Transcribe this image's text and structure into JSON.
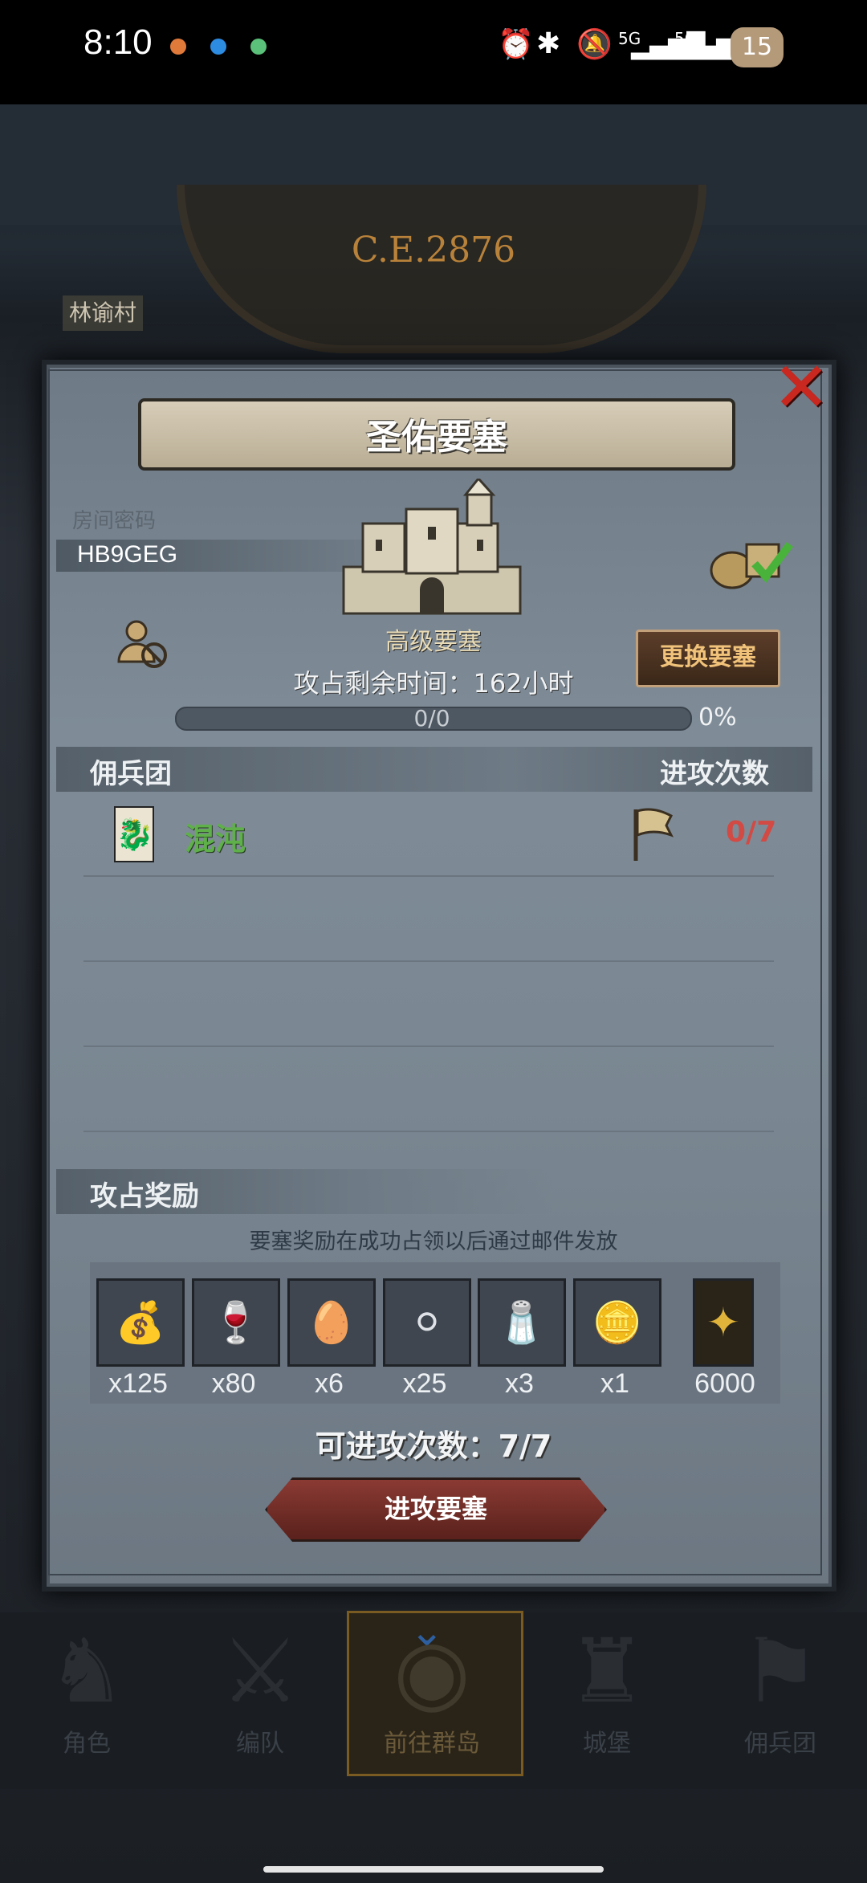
{
  "status_bar": {
    "time": "8:10",
    "battery": "15",
    "signal1": "5G",
    "signal2": "5G"
  },
  "background": {
    "era": "C.E.2876",
    "village": "林谕村"
  },
  "dialog": {
    "title": "圣佑要塞",
    "room_password_label": "房间密码",
    "room_password": "HB9GEG",
    "fortress_grade": "高级要塞",
    "change_button": "更换要塞",
    "time_left": "攻占剩余时间：162小时",
    "progress_text": "0/0",
    "progress_percent": "0%",
    "progress_value": 0,
    "columns": {
      "mercenary": "佣兵团",
      "attacks": "进攻次数"
    },
    "rows": [
      {
        "guild": "混沌",
        "guild_emblem": "🐉",
        "attacks": "0/7"
      }
    ],
    "rewards_title": "攻占奖励",
    "rewards_note": "要塞奖励在成功占领以后通过邮件发放",
    "rewards": [
      {
        "icon": "sack-icon",
        "glyph": "💰",
        "qty": "x125"
      },
      {
        "icon": "goblet-icon",
        "glyph": "🍷",
        "qty": "x80"
      },
      {
        "icon": "stone-icon",
        "glyph": "🥚",
        "qty": "x6"
      },
      {
        "icon": "silver-orb-icon",
        "glyph": "⚪",
        "qty": "x25"
      },
      {
        "icon": "powder-icon",
        "glyph": "🧂",
        "qty": "x3"
      },
      {
        "icon": "helmet-coin-icon",
        "glyph": "🪙",
        "qty": "x1"
      },
      {
        "icon": "rank-badge-icon",
        "glyph": "✦",
        "qty": "6000"
      }
    ],
    "attacks_left": "可进攻次数：7/7",
    "attack_button": "进攻要塞"
  },
  "nav": {
    "items": [
      {
        "label": "角色",
        "glyph": "♞"
      },
      {
        "label": "编队",
        "glyph": "⚔"
      },
      {
        "label": "前往群岛",
        "glyph": "◉"
      },
      {
        "label": "城堡",
        "glyph": "♜"
      },
      {
        "label": "佣兵团",
        "glyph": "⚑"
      }
    ]
  },
  "colors": {
    "accent_red": "#d24a43",
    "guild_green": "#5fb04a",
    "button_gold": "#f0c27a"
  }
}
